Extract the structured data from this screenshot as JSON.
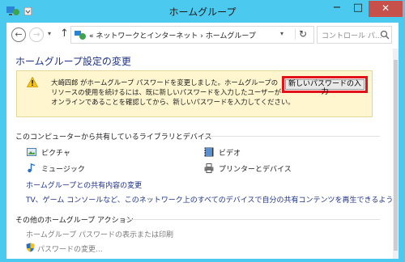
{
  "window": {
    "title": "ホームグループ",
    "min_label": "−",
    "max_label": "□",
    "close_label": "✕"
  },
  "nav": {
    "back_label": "←",
    "forward_label": "→",
    "history_label": "▾",
    "up_label": "↑",
    "address": "«  ネットワークとインターネット  ›  ホームグループ",
    "address_drop": "▾",
    "refresh_label": "↻",
    "search_placeholder": "コントロール パ..."
  },
  "page": {
    "title": "ホームグループ設定の変更",
    "warning": {
      "lines": [
        "大崎四郎 がホームグループ パスワードを変更しました。ホームグループの",
        "リソースの使用を続けるには、既に新しいパスワードを入力したユーザーが",
        "オンラインであることを確認してから、新しいパスワードを入力してください。"
      ],
      "button_label": "新しいパスワードの入力",
      "highlight_color": "#e1121a"
    },
    "shared": {
      "heading": "このコンピューターから共有しているライブラリとデバイス",
      "items": [
        {
          "label": "ピクチャ",
          "icon": "pictures-icon"
        },
        {
          "label": "ビデオ",
          "icon": "videos-icon"
        },
        {
          "label": "ミュージック",
          "icon": "music-icon"
        },
        {
          "label": "プリンターとデバイス",
          "icon": "printer-icon"
        }
      ],
      "link_change": "ホームグループとの共有内容の変更",
      "link_stream": "TV、ゲーム コンソールなど、このネットワーク上のすべてのデバイスで自分の共有コンテンツを再生できるようにします"
    },
    "other": {
      "heading": "その他のホームグループ アクション",
      "link_print": "ホームグループ パスワードの表示または印刷",
      "link_change_password": "パスワードの変更..."
    }
  }
}
